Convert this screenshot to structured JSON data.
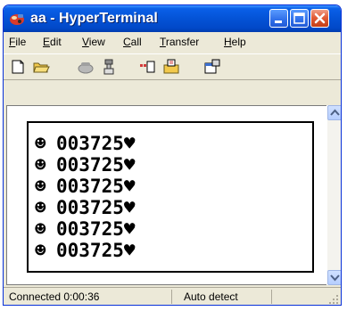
{
  "window": {
    "title": "aa - HyperTerminal",
    "icon": "hyperterminal-app-icon",
    "controls": [
      "minimize-icon",
      "maximize-icon",
      "close-icon"
    ],
    "title_color": "#ffffff",
    "titlebar_color": "#0453d6"
  },
  "menu": {
    "items": [
      {
        "label": "File",
        "mnemonic": "F"
      },
      {
        "label": "Edit",
        "mnemonic": "E"
      },
      {
        "label": "View",
        "mnemonic": "V"
      },
      {
        "label": "Call",
        "mnemonic": "C"
      },
      {
        "label": "Transfer",
        "mnemonic": "T"
      },
      {
        "label": "Help",
        "mnemonic": "H"
      }
    ]
  },
  "toolbar": {
    "buttons": [
      "new-icon",
      "open-icon",
      "call-icon",
      "disconnect-icon",
      "send-icon",
      "receive-icon",
      "properties-icon"
    ]
  },
  "terminal": {
    "lines": [
      {
        "prefix": "☻",
        "value": "003725",
        "suffix": "♥"
      },
      {
        "prefix": "☻",
        "value": "003725",
        "suffix": "♥"
      },
      {
        "prefix": "☻",
        "value": "003725",
        "suffix": "♥"
      },
      {
        "prefix": "☻",
        "value": "003725",
        "suffix": "♥"
      },
      {
        "prefix": "☻",
        "value": "003725",
        "suffix": "♥"
      },
      {
        "prefix": "☻",
        "value": "003725",
        "suffix": "♥"
      }
    ]
  },
  "status": {
    "connection": "Connected 0:00:36",
    "detect": "Auto detect"
  }
}
